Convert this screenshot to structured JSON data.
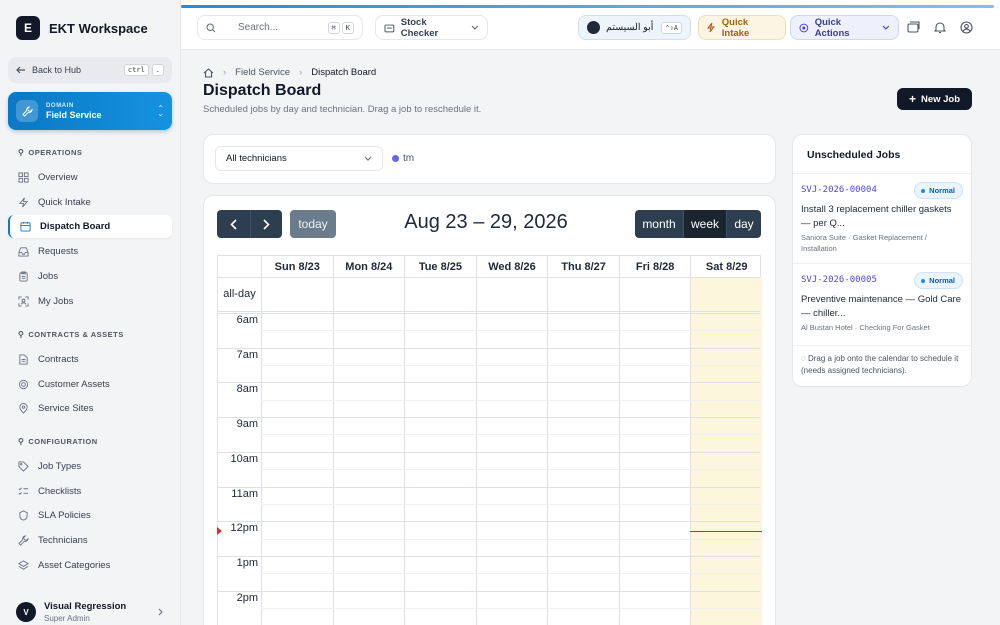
{
  "brand": {
    "logo": "E",
    "name": "EKT Workspace"
  },
  "sidebar": {
    "back": {
      "label": "Back to Hub",
      "kbd1": "ctrl",
      "kbd2": "."
    },
    "domain": {
      "caption": "DOMAIN",
      "value": "Field Service"
    },
    "sections": [
      {
        "title": "OPERATIONS",
        "items": [
          {
            "label": "Overview",
            "icon": "grid-icon"
          },
          {
            "label": "Quick Intake",
            "icon": "lightning-icon"
          },
          {
            "label": "Dispatch Board",
            "icon": "calendar-icon",
            "active": true
          },
          {
            "label": "Requests",
            "icon": "inbox-icon"
          },
          {
            "label": "Jobs",
            "icon": "clipboard-icon"
          },
          {
            "label": "My Jobs",
            "icon": "user-target-icon"
          }
        ]
      },
      {
        "title": "CONTRACTS & ASSETS",
        "items": [
          {
            "label": "Contracts",
            "icon": "document-icon"
          },
          {
            "label": "Customer Assets",
            "icon": "cog-icon"
          },
          {
            "label": "Service Sites",
            "icon": "map-pin-icon"
          }
        ]
      },
      {
        "title": "CONFIGURATION",
        "items": [
          {
            "label": "Job Types",
            "icon": "tag-icon"
          },
          {
            "label": "Checklists",
            "icon": "list-check-icon"
          },
          {
            "label": "SLA Policies",
            "icon": "shield-icon"
          },
          {
            "label": "Technicians",
            "icon": "wrench-icon"
          },
          {
            "label": "Asset Categories",
            "icon": "layers-icon"
          }
        ]
      }
    ],
    "user": {
      "initial": "V",
      "name": "Visual Regression",
      "role": "Super Admin"
    }
  },
  "topbar": {
    "search_placeholder": "Search...",
    "search_kbd1": "⌘",
    "search_kbd2": "K",
    "app_select": "Stock Checker",
    "user_chip": "أبو السيستم",
    "user_kbd": "⌃⇧A",
    "quick_intake": "Quick Intake",
    "quick_actions": "Quick Actions"
  },
  "breadcrumb": {
    "level1": "Field Service",
    "current": "Dispatch Board"
  },
  "page": {
    "title": "Dispatch Board",
    "subtitle": "Scheduled jobs by day and technician. Drag a job to reschedule it.",
    "new_job": "New Job"
  },
  "filters": {
    "technician": "All technicians",
    "legend": "tm",
    "legend_color": "#6366f1"
  },
  "calendar": {
    "title": "Aug 23 – 29, 2026",
    "today_btn": "today",
    "views": [
      "month",
      "week",
      "day"
    ],
    "active_view": "week",
    "days": [
      "Sun 8/23",
      "Mon 8/24",
      "Tue 8/25",
      "Wed 8/26",
      "Thu 8/27",
      "Fri 8/28",
      "Sat 8/29"
    ],
    "today_index": 6,
    "allday_label": "all-day",
    "times": [
      "6am",
      "7am",
      "8am",
      "9am",
      "10am",
      "11am",
      "12pm",
      "1pm",
      "2pm"
    ],
    "today_color": "#fcf6dd",
    "now_color": "#d12f2f"
  },
  "unscheduled": {
    "title": "Unscheduled Jobs",
    "jobs": [
      {
        "code": "SVJ-2026-00004",
        "priority": "Normal",
        "title": "Install 3 replacement chiller gaskets — per Q...",
        "meta": "Saniora Suite · Gasket Replacement / Installation"
      },
      {
        "code": "SVJ-2026-00005",
        "priority": "Normal",
        "title": "Preventive maintenance — Gold Care — chiller...",
        "meta": "Al Bustan Hotel · Checking For Gasket"
      }
    ],
    "hint": "Drag a job onto the calendar to schedule it (needs assigned technicians)."
  }
}
